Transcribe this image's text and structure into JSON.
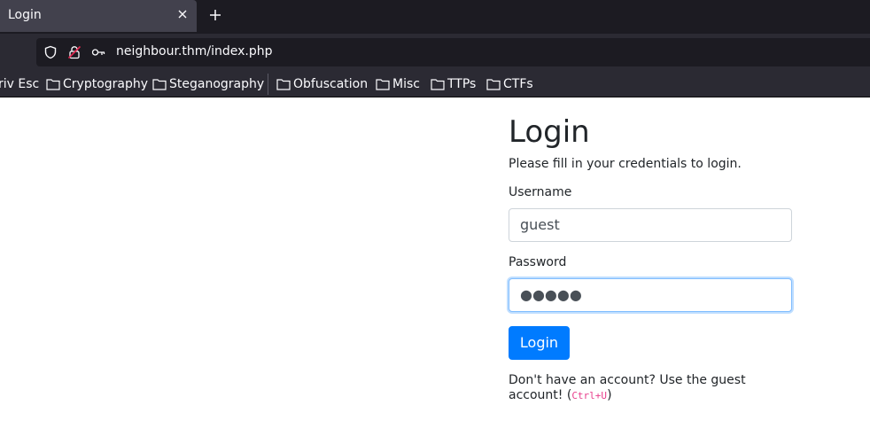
{
  "browser": {
    "tab_title": "Login",
    "url": "neighbour.thm/index.php",
    "bookmarks": [
      "riv Esc",
      "Cryptography",
      "Steganography",
      "Obfuscation",
      "Misc",
      "TTPs",
      "CTFs"
    ]
  },
  "page": {
    "title": "Login",
    "subtitle": "Please fill in your credentials to login.",
    "username_label": "Username",
    "username_value": "guest",
    "password_label": "Password",
    "password_value": "●●●●●",
    "submit_label": "Login",
    "footer_text": "Don't have an account? Use the guest account! (",
    "footer_shortcut": "Ctrl+U",
    "footer_end": ")"
  },
  "colors": {
    "accent": "#007bff",
    "kbd": "#e83e8c"
  }
}
